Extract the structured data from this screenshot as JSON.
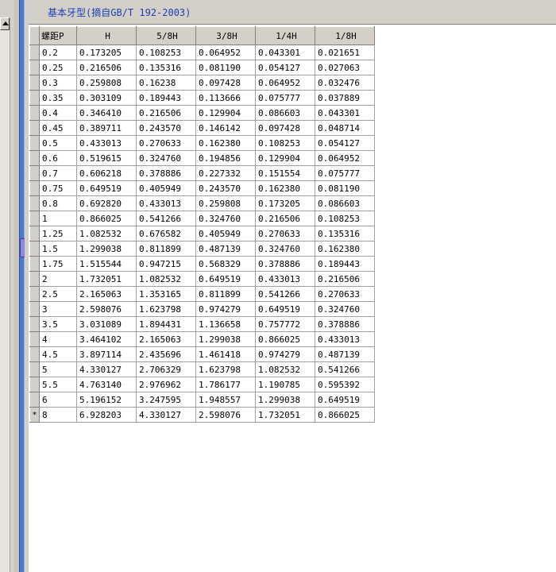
{
  "caption": "基本牙型(摘自GB/T 192-2003)",
  "columns": [
    "螺距P",
    "H",
    "5/8H",
    "3/8H",
    "1/4H",
    "1/8H"
  ],
  "new_row_marker": "*",
  "rows": [
    [
      "0.2",
      "0.173205",
      "0.108253",
      "0.064952",
      "0.043301",
      "0.021651"
    ],
    [
      "0.25",
      "0.216506",
      "0.135316",
      "0.081190",
      "0.054127",
      "0.027063"
    ],
    [
      "0.3",
      "0.259808",
      "0.16238",
      "0.097428",
      "0.064952",
      "0.032476"
    ],
    [
      "0.35",
      "0.303109",
      "0.189443",
      "0.113666",
      "0.075777",
      "0.037889"
    ],
    [
      "0.4",
      "0.346410",
      "0.216506",
      "0.129904",
      "0.086603",
      "0.043301"
    ],
    [
      "0.45",
      "0.389711",
      "0.243570",
      "0.146142",
      "0.097428",
      "0.048714"
    ],
    [
      "0.5",
      "0.433013",
      "0.270633",
      "0.162380",
      "0.108253",
      "0.054127"
    ],
    [
      "0.6",
      "0.519615",
      "0.324760",
      "0.194856",
      "0.129904",
      "0.064952"
    ],
    [
      "0.7",
      "0.606218",
      "0.378886",
      "0.227332",
      "0.151554",
      "0.075777"
    ],
    [
      "0.75",
      "0.649519",
      "0.405949",
      "0.243570",
      "0.162380",
      "0.081190"
    ],
    [
      "0.8",
      "0.692820",
      "0.433013",
      "0.259808",
      "0.173205",
      "0.086603"
    ],
    [
      "1",
      "0.866025",
      "0.541266",
      "0.324760",
      "0.216506",
      "0.108253"
    ],
    [
      "1.25",
      "1.082532",
      "0.676582",
      "0.405949",
      "0.270633",
      "0.135316"
    ],
    [
      "1.5",
      "1.299038",
      "0.811899",
      "0.487139",
      "0.324760",
      "0.162380"
    ],
    [
      "1.75",
      "1.515544",
      "0.947215",
      "0.568329",
      "0.378886",
      "0.189443"
    ],
    [
      "2",
      "1.732051",
      "1.082532",
      "0.649519",
      "0.433013",
      "0.216506"
    ],
    [
      "2.5",
      "2.165063",
      "1.353165",
      "0.811899",
      "0.541266",
      "0.270633"
    ],
    [
      "3",
      "2.598076",
      "1.623798",
      "0.974279",
      "0.649519",
      "0.324760"
    ],
    [
      "3.5",
      "3.031089",
      "1.894431",
      "1.136658",
      "0.757772",
      "0.378886"
    ],
    [
      "4",
      "3.464102",
      "2.165063",
      "1.299038",
      "0.866025",
      "0.433013"
    ],
    [
      "4.5",
      "3.897114",
      "2.435696",
      "1.461418",
      "0.974279",
      "0.487139"
    ],
    [
      "5",
      "4.330127",
      "2.706329",
      "1.623798",
      "1.082532",
      "0.541266"
    ],
    [
      "5.5",
      "4.763140",
      "2.976962",
      "1.786177",
      "1.190785",
      "0.595392"
    ],
    [
      "6",
      "5.196152",
      "3.247595",
      "1.948557",
      "1.299038",
      "0.649519"
    ],
    [
      "8",
      "6.928203",
      "4.330127",
      "2.598076",
      "1.732051",
      "0.866025"
    ]
  ]
}
